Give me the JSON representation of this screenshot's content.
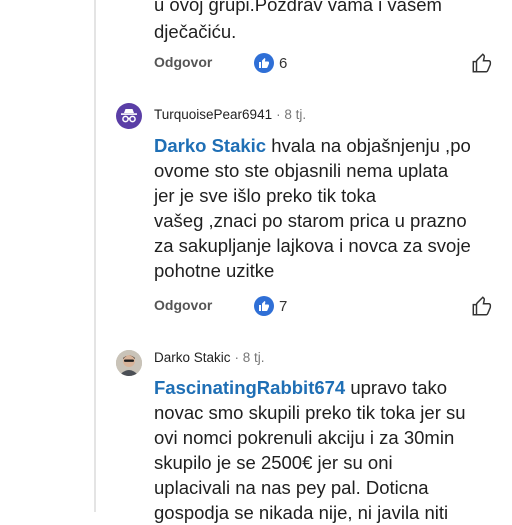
{
  "comment1": {
    "lines": [
      "u ovoj grupi.Pozdrav vama i vašem",
      "dječačiću."
    ],
    "reply_label": "Odgovor",
    "likes": "6"
  },
  "comment2": {
    "author": "TurquoisePear6941",
    "age": "· 8 tj.",
    "mention": "Darko Stakic",
    "first_line_rest": " hvala na objašnjenju ,po",
    "lines": [
      "ovome sto ste objasnili nema uplata",
      "jer je sve išlo preko tik toka",
      "vašeg ,znaci po starom prica u prazno",
      "za sakupljanje lajkova i novca za svoje",
      "pohotne uzitke"
    ],
    "reply_label": "Odgovor",
    "likes": "7"
  },
  "comment3": {
    "author": "Darko Stakic",
    "age": "· 8 tj.",
    "mention": "FascinatingRabbit674",
    "first_line_rest": "  upravo tako",
    "lines": [
      "novac smo skupili preko tik toka jer su",
      "ovi nomci pokrenuli akciju i za 30min",
      "skupilo je se 2500€ jer su oni",
      "uplacivali na nas pey pal. Doticna",
      "gospodja se nikada nije, ni javila niti"
    ]
  },
  "colors": {
    "accent": "#2f6fd6",
    "mention": "#1f6fb5"
  },
  "icons": [
    "like-filled-icon",
    "thumb-up-outline-icon",
    "incognito-avatar-icon",
    "user-avatar-icon"
  ]
}
